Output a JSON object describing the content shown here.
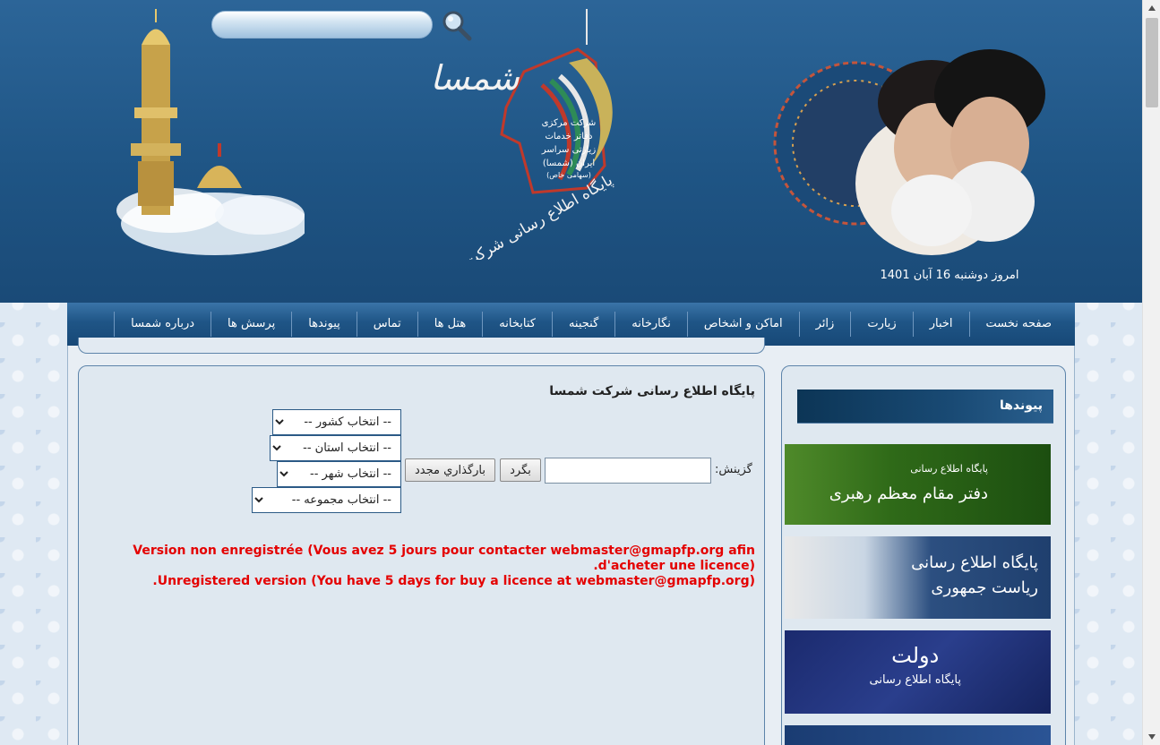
{
  "header": {
    "search_placeholder": "",
    "date_text": "امروز دوشنبه 16 آبان 1401",
    "logo_text_lines": [
      "شمسا",
      "پایگاه اطلاع رسانی شرکت مرکزی دفاتر خدمات زیارتی سراسر ایران"
    ],
    "logo_badge_lines": [
      "شرکت مرکزی",
      "دفاتر خدمات",
      "زیارتی سراسر",
      "ایران (شمسا)",
      "(سهامی خاص)"
    ]
  },
  "nav": {
    "items": [
      "صفحه نخست",
      "اخبار",
      "زیارت",
      "زائر",
      "اماکن و اشخاص",
      "نگارخانه",
      "گنجینه",
      "کتابخانه",
      "هتل ها",
      "تماس",
      "پیوندها",
      "پرسش ها",
      "درباره شمسا"
    ]
  },
  "main": {
    "title": "پایگاه اطلاع رسانی شرکت شمسا",
    "selects": {
      "country": "-- انتخاب کشور --",
      "province": "-- انتخاب استان --",
      "city": "-- انتخاب شهر --",
      "group": "-- انتخاب مجموعه --"
    },
    "option_label": "گزينش:",
    "option_value": "",
    "back_button": "بگرد",
    "reload_button": "بارگذاري مجدد",
    "warning_line1": "Version non enregistrée (Vous avez 5 jours pour contacter webmaster@gmapfp.org afin d'acheter une licence).",
    "warning_line2": "Unregistered version (You have 5 days for buy a licence at webmaster@gmapfp.org)."
  },
  "sidebar": {
    "title": "پیوندها",
    "banners": [
      {
        "lines": [
          "پایگاه اطلاع رسانی",
          "دفتر مقام معظم رهبری"
        ]
      },
      {
        "lines": [
          "پایگاه اطلاع رسانی",
          "ریاست جمهوری"
        ]
      },
      {
        "lines": [
          "دولت",
          "پایگاه اطلاع رسانی"
        ]
      },
      {
        "lines": []
      }
    ]
  },
  "colors": {
    "header_bg": "#1f5585",
    "nav_bg": "#1f5586",
    "panel_border": "#5d84aa",
    "warning": "#e40000"
  }
}
